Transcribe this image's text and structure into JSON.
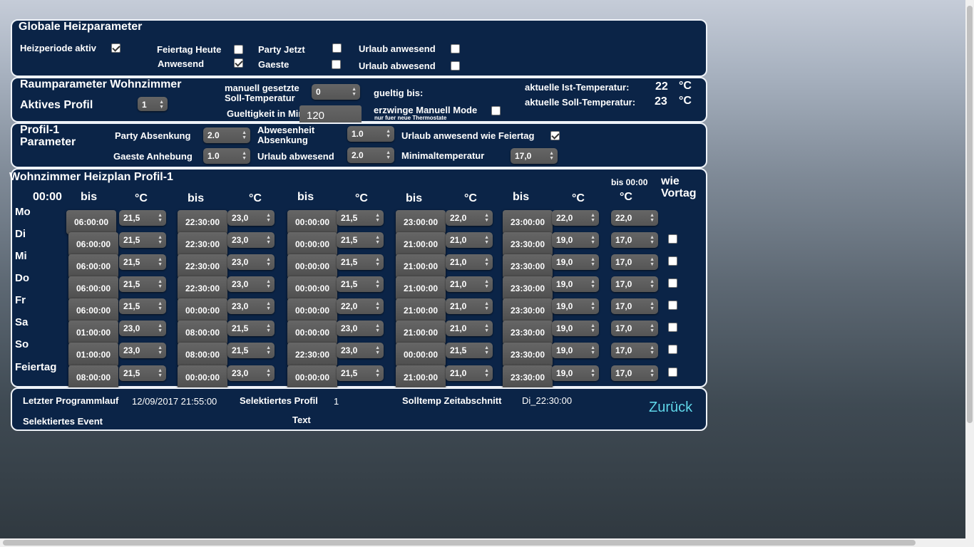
{
  "global": {
    "title": "Globale Heizparameter",
    "heizperiode": "Heizperiode aktiv",
    "feiertag": "Feiertag Heute",
    "anwesend": "Anwesend",
    "party": "Party Jetzt",
    "gaeste": "Gaeste",
    "urlaub_anw": "Urlaub anwesend",
    "urlaub_abw": "Urlaub abwesend"
  },
  "room": {
    "title": "Raumparameter Wohnzimmer",
    "aktives_profil": "Aktives Profil",
    "profil_value": "1",
    "manuell_line1": "manuell gesetzte",
    "manuell_line2": "Soll-Temperatur",
    "manuell_value": "0",
    "gueltig_bis": "gueltig bis:",
    "gueltigkeit_min": "Gueltigkeit in Min",
    "gueltigkeit_value": "120",
    "erzwinge": "erzwinge Manuell Mode",
    "erzwinge_sub": "nur fuer neue Thermostate",
    "ist_label": "aktuelle Ist-Temperatur:",
    "ist_value": "22",
    "soll_label": "aktuelle Soll-Temperatur:",
    "soll_value": "23",
    "unit": "°C"
  },
  "profile": {
    "title_line1": "Profil-1",
    "title_line2": "Parameter",
    "party_abs": "Party Absenkung",
    "party_abs_value": "2.0",
    "gaeste_anh": "Gaeste Anhebung",
    "gaeste_anh_value": "1.0",
    "abw_abs_line1": "Abwesenheit",
    "abw_abs_line2": "Absenkung",
    "abw_abs_value": "1.0",
    "urlaub_abw": "Urlaub abwesend",
    "urlaub_abw_value": "2.0",
    "urlaub_anw_feiertag": "Urlaub anwesend wie Feiertag",
    "mintemp": "Minimaltemperatur",
    "mintemp_value": "17,0"
  },
  "plan": {
    "title": "Wohnzimmer Heizplan Profil-1",
    "start": "00:00",
    "bis": "bis",
    "unit": "°C",
    "bis0000": "bis 00:00",
    "wie_line1": "wie",
    "wie_line2": "Vortag",
    "days": [
      {
        "day": "Mo",
        "t": [
          "06:00:00",
          "22:30:00",
          "00:00:00",
          "23:00:00",
          "23:00:00"
        ],
        "c": [
          "21,5",
          "23,0",
          "21,5",
          "22,0",
          "22,0"
        ],
        "end": "22,0"
      },
      {
        "day": "Di",
        "t": [
          "06:00:00",
          "22:30:00",
          "00:00:00",
          "21:00:00",
          "23:30:00"
        ],
        "c": [
          "21,5",
          "23,0",
          "21,5",
          "21,0",
          "19,0"
        ],
        "end": "17,0"
      },
      {
        "day": "Mi",
        "t": [
          "06:00:00",
          "22:30:00",
          "00:00:00",
          "21:00:00",
          "23:30:00"
        ],
        "c": [
          "21,5",
          "23,0",
          "21,5",
          "21,0",
          "19,0"
        ],
        "end": "17,0"
      },
      {
        "day": "Do",
        "t": [
          "06:00:00",
          "22:30:00",
          "00:00:00",
          "21:00:00",
          "23:30:00"
        ],
        "c": [
          "21,5",
          "23,0",
          "21,5",
          "21,0",
          "19,0"
        ],
        "end": "17,0"
      },
      {
        "day": "Fr",
        "t": [
          "06:00:00",
          "00:00:00",
          "00:00:00",
          "21:00:00",
          "23:30:00"
        ],
        "c": [
          "21,5",
          "23,0",
          "22,0",
          "21,0",
          "19,0"
        ],
        "end": "17,0"
      },
      {
        "day": "Sa",
        "t": [
          "01:00:00",
          "08:00:00",
          "00:00:00",
          "21:00:00",
          "23:30:00"
        ],
        "c": [
          "23,0",
          "21,5",
          "23,0",
          "21,0",
          "19,0"
        ],
        "end": "17,0"
      },
      {
        "day": "So",
        "t": [
          "01:00:00",
          "08:00:00",
          "22:30:00",
          "00:00:00",
          "23:30:00"
        ],
        "c": [
          "23,0",
          "21,5",
          "23,0",
          "21,5",
          "19,0"
        ],
        "end": "17,0"
      },
      {
        "day": "Feiertag",
        "t": [
          "08:00:00",
          "00:00:00",
          "00:00:00",
          "21:00:00",
          "23:30:00"
        ],
        "c": [
          "21,5",
          "23,0",
          "21,5",
          "21,0",
          "19,0"
        ],
        "end": "17,0"
      }
    ]
  },
  "footer": {
    "letzter": "Letzter Programmlauf",
    "letzter_value": "12/09/2017 21:55:00",
    "sel_profil": "Selektiertes Profil",
    "sel_profil_value": "1",
    "solltemp": "Solltemp Zeitabschnitt",
    "solltemp_value": "Di_22:30:00",
    "sel_event": "Selektiertes Event",
    "text": "Text",
    "back": "Zurück"
  }
}
